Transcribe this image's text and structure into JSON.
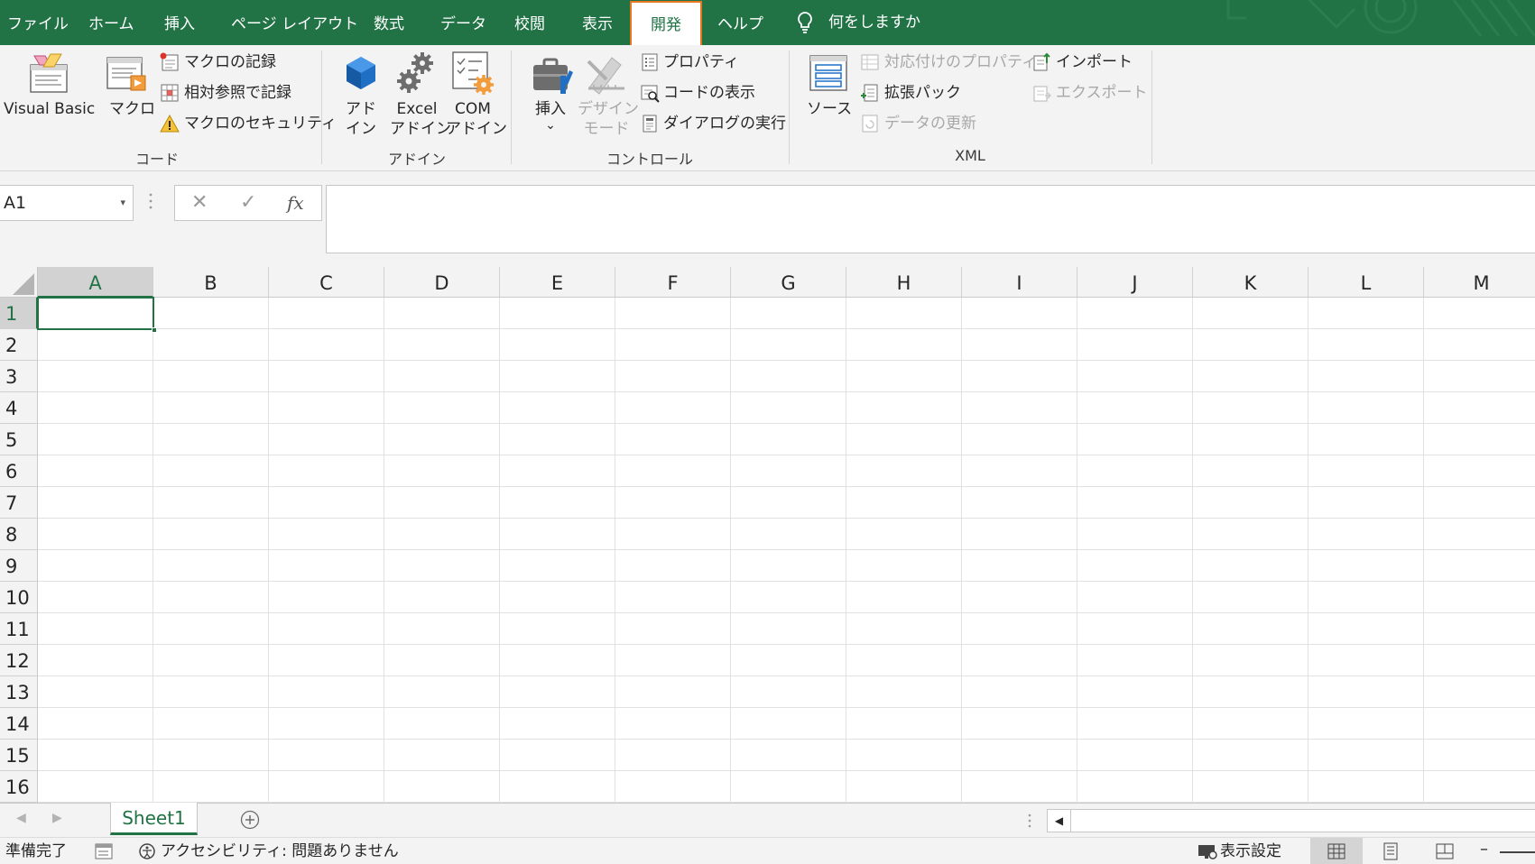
{
  "tabs": [
    {
      "id": "file",
      "label": "ファイル"
    },
    {
      "id": "home",
      "label": "ホーム"
    },
    {
      "id": "insert",
      "label": "挿入"
    },
    {
      "id": "page-layout",
      "label": "ページ レイアウト"
    },
    {
      "id": "formulas",
      "label": "数式"
    },
    {
      "id": "data",
      "label": "データ"
    },
    {
      "id": "review",
      "label": "校閲"
    },
    {
      "id": "view",
      "label": "表示"
    },
    {
      "id": "developer",
      "label": "開発",
      "active": true
    },
    {
      "id": "help",
      "label": "ヘルプ"
    }
  ],
  "tell_me": {
    "icon": "lightbulb-icon",
    "label": "何をしますか"
  },
  "ribbon": {
    "code": {
      "group_label": "コード",
      "visual_basic": "Visual Basic",
      "macros": "マクロ",
      "record_macro": "マクロの記録",
      "relative_ref": "相対参照で記録",
      "macro_security": "マクロのセキュリティ"
    },
    "addins": {
      "group_label": "アドイン",
      "addins_l1": "アド",
      "addins_l2": "イン",
      "excel_addins_l1": "Excel",
      "excel_addins_l2": "アドイン",
      "com_addins_l1": "COM",
      "com_addins_l2": "アドイン"
    },
    "controls": {
      "group_label": "コントロール",
      "insert": "挿入",
      "insert_caret": "⌄",
      "design_mode_l1": "デザイン",
      "design_mode_l2": "モード",
      "properties": "プロパティ",
      "view_code": "コードの表示",
      "run_dialog": "ダイアログの実行"
    },
    "xml": {
      "group_label": "XML",
      "source": "ソース",
      "map_properties": "対応付けのプロパティ",
      "expansion_packs": "拡張パック",
      "refresh_data": "データの更新",
      "import": "インポート",
      "export": "エクスポート"
    }
  },
  "formula_bar": {
    "name_box": "A1",
    "name_box_caret": "▾",
    "cancel": "✕",
    "enter": "✓",
    "fx": "fx",
    "value": ""
  },
  "grid": {
    "columns": [
      "A",
      "B",
      "C",
      "D",
      "E",
      "F",
      "G",
      "H",
      "I",
      "J",
      "K",
      "L",
      "M"
    ],
    "rows": [
      "1",
      "2",
      "3",
      "4",
      "5",
      "6",
      "7",
      "8",
      "9",
      "10",
      "11",
      "12",
      "13",
      "14",
      "15",
      "16"
    ],
    "active_cell": "A1"
  },
  "sheets": {
    "nav_prev": "◀",
    "nav_next": "▶",
    "tabs": [
      "Sheet1"
    ],
    "scroll_left": "◀"
  },
  "status_bar": {
    "ready": "準備完了",
    "accessibility": "アクセシビリティ: 問題ありません",
    "display_settings": "表示設定",
    "zoom_minus": "–"
  },
  "colors": {
    "brand_green": "#217346",
    "highlight_orange": "#e87722",
    "ribbon_bg": "#f3f3f3"
  }
}
